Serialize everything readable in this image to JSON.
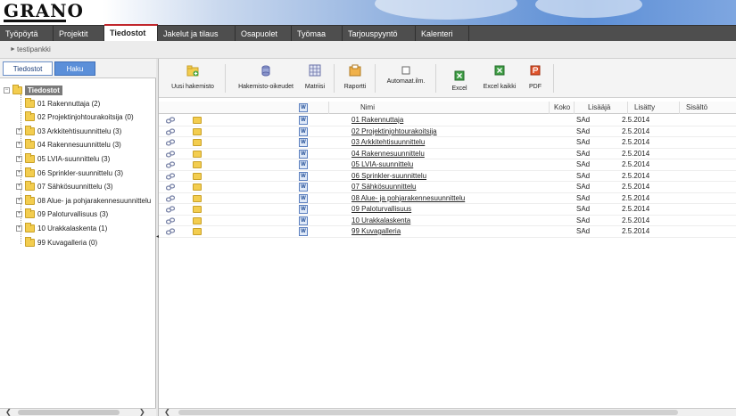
{
  "app": {
    "logo_text": "GRANO"
  },
  "nav": {
    "tabs": [
      "Työpöytä",
      "Projektit",
      "Tiedostot",
      "Jakelut ja tilaus",
      "Osapuolet",
      "Työmaa",
      "Tarjouspyyntö",
      "Kalenteri"
    ],
    "active": "Tiedostot"
  },
  "breadcrumb": {
    "text": "testipankki"
  },
  "left": {
    "tabs": {
      "files": "Tiedostot",
      "search": "Haku"
    },
    "root": "Tiedostot",
    "items": [
      {
        "label": "01 Rakennuttaja (2)",
        "expandable": false
      },
      {
        "label": "02 Projektinjohtourakoitsija (0)",
        "expandable": false
      },
      {
        "label": "03 Arkkitehtisuunnittelu (3)",
        "expandable": true
      },
      {
        "label": "04 Rakennesuunnittelu (3)",
        "expandable": true
      },
      {
        "label": "05 LVIA-suunnittelu (3)",
        "expandable": true
      },
      {
        "label": "06 Sprinkler-suunnittelu (3)",
        "expandable": true
      },
      {
        "label": "07 Sähkösuunnittelu (3)",
        "expandable": true
      },
      {
        "label": "08 Alue- ja pohjarakennesuunnittelu",
        "expandable": true
      },
      {
        "label": "09 Paloturvallisuus (3)",
        "expandable": true
      },
      {
        "label": "10 Urakkalaskenta (1)",
        "expandable": true
      },
      {
        "label": "99 Kuvagalleria (0)",
        "expandable": false
      }
    ]
  },
  "toolbar": {
    "new_folder": "Uusi hakemisto",
    "folder_rights": "Hakemisto-oikeudet",
    "matrix": "Matriisi",
    "report": "Raportti",
    "auto_notify": "Automaat.ilm.",
    "excel": "Excel",
    "excel_all": "Excel kaikki",
    "pdf": "PDF"
  },
  "grid": {
    "headers": {
      "name": "Nimi",
      "size": "Koko",
      "added_by": "Lisääjä",
      "added": "Lisätty",
      "content": "Sisältö"
    },
    "rows": [
      {
        "name": "01 Rakennuttaja",
        "added_by": "SAd",
        "added": "2.5.2014"
      },
      {
        "name": "02 Projektinjohtourakoitsija",
        "added_by": "SAd",
        "added": "2.5.2014"
      },
      {
        "name": "03 Arkkitehtisuunnittelu",
        "added_by": "SAd",
        "added": "2.5.2014"
      },
      {
        "name": "04 Rakennesuunnittelu",
        "added_by": "SAd",
        "added": "2.5.2014"
      },
      {
        "name": "05 LVIA-suunnittelu",
        "added_by": "SAd",
        "added": "2.5.2014"
      },
      {
        "name": "06 Sprinkler-suunnittelu",
        "added_by": "SAd",
        "added": "2.5.2014"
      },
      {
        "name": "07 Sähkösuunnittelu",
        "added_by": "SAd",
        "added": "2.5.2014"
      },
      {
        "name": "08 Alue- ja pohjarakennesuunnittelu",
        "added_by": "SAd",
        "added": "2.5.2014"
      },
      {
        "name": "09 Paloturvallisuus",
        "added_by": "SAd",
        "added": "2.5.2014"
      },
      {
        "name": "10 Urakkalaskenta",
        "added_by": "SAd",
        "added": "2.5.2014"
      },
      {
        "name": "99 Kuvagalleria",
        "added_by": "SAd",
        "added": "2.5.2014"
      }
    ]
  },
  "colors": {
    "active_tab_accent": "#c1272d",
    "nav_bg": "#4e4e4e",
    "haku_tab": "#5b8fd9",
    "folder": "#f3cd4f"
  }
}
